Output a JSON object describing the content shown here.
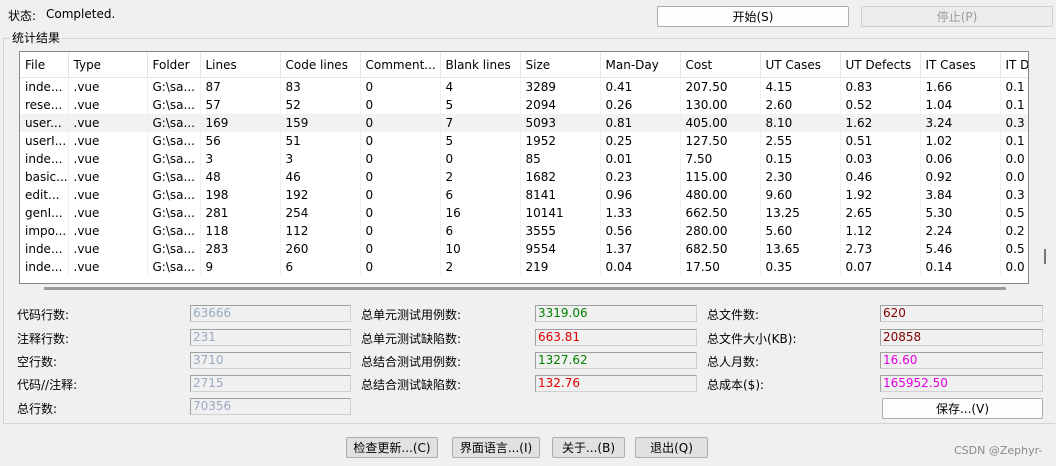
{
  "status": {
    "label": "状态:",
    "value": "Completed."
  },
  "controls": {
    "start": "开始(S)",
    "stop": "停止(P)"
  },
  "group_title": "统计结果",
  "table": {
    "columns": [
      "File",
      "Type",
      "Folder",
      "Lines",
      "Code lines",
      "Comment...",
      "Blank lines",
      "Size",
      "Man-Day",
      "Cost",
      "UT Cases",
      "UT Defects",
      "IT Cases",
      "IT D"
    ],
    "rows": [
      [
        "inde...",
        ".vue",
        "G:\\sa...",
        "87",
        "83",
        "0",
        "4",
        "3289",
        "0.41",
        "207.50",
        "4.15",
        "0.83",
        "1.66",
        "0.1"
      ],
      [
        "rese...",
        ".vue",
        "G:\\sa...",
        "57",
        "52",
        "0",
        "5",
        "2094",
        "0.26",
        "130.00",
        "2.60",
        "0.52",
        "1.04",
        "0.1"
      ],
      [
        "user...",
        ".vue",
        "G:\\sa...",
        "169",
        "159",
        "0",
        "7",
        "5093",
        "0.81",
        "405.00",
        "8.10",
        "1.62",
        "3.24",
        "0.3"
      ],
      [
        "userI...",
        ".vue",
        "G:\\sa...",
        "56",
        "51",
        "0",
        "5",
        "1952",
        "0.25",
        "127.50",
        "2.55",
        "0.51",
        "1.02",
        "0.1"
      ],
      [
        "inde...",
        ".vue",
        "G:\\sa...",
        "3",
        "3",
        "0",
        "0",
        "85",
        "0.01",
        "7.50",
        "0.15",
        "0.03",
        "0.06",
        "0.0"
      ],
      [
        "basic...",
        ".vue",
        "G:\\sa...",
        "48",
        "46",
        "0",
        "2",
        "1682",
        "0.23",
        "115.00",
        "2.30",
        "0.46",
        "0.92",
        "0.0"
      ],
      [
        "edit...",
        ".vue",
        "G:\\sa...",
        "198",
        "192",
        "0",
        "6",
        "8141",
        "0.96",
        "480.00",
        "9.60",
        "1.92",
        "3.84",
        "0.3"
      ],
      [
        "genI...",
        ".vue",
        "G:\\sa...",
        "281",
        "254",
        "0",
        "16",
        "10141",
        "1.33",
        "662.50",
        "13.25",
        "2.65",
        "5.30",
        "0.5"
      ],
      [
        "impo...",
        ".vue",
        "G:\\sa...",
        "118",
        "112",
        "0",
        "6",
        "3555",
        "0.56",
        "280.00",
        "5.60",
        "1.12",
        "2.24",
        "0.2"
      ],
      [
        "inde...",
        ".vue",
        "G:\\sa...",
        "283",
        "260",
        "0",
        "10",
        "9554",
        "1.37",
        "682.50",
        "13.65",
        "2.73",
        "5.46",
        "0.5"
      ],
      [
        "inde...",
        ".vue",
        "G:\\sa...",
        "9",
        "6",
        "0",
        "2",
        "219",
        "0.04",
        "17.50",
        "0.35",
        "0.07",
        "0.14",
        "0.0"
      ]
    ],
    "selected_row": 2
  },
  "stats": {
    "code_lines": {
      "label": "代码行数:",
      "value": "63666"
    },
    "comment_lines": {
      "label": "注释行数:",
      "value": "231"
    },
    "blank_lines": {
      "label": "空行数:",
      "value": "3710"
    },
    "code_comment": {
      "label": "代码//注释:",
      "value": "2715"
    },
    "total_lines": {
      "label": "总行数:",
      "value": "70356"
    },
    "ut_cases": {
      "label": "总单元测试用例数:",
      "value": "3319.06"
    },
    "ut_defects": {
      "label": "总单元测试缺陷数:",
      "value": "663.81"
    },
    "it_cases": {
      "label": "总结合测试用例数:",
      "value": "1327.62"
    },
    "it_defects": {
      "label": "总结合测试缺陷数:",
      "value": "132.76"
    },
    "file_count": {
      "label": "总文件数:",
      "value": "620"
    },
    "file_size": {
      "label": "总文件大小(KB):",
      "value": "20858"
    },
    "man_months": {
      "label": "总人月数:",
      "value": "16.60"
    },
    "total_cost": {
      "label": "总成本($):",
      "value": "165952.50"
    }
  },
  "colors": {
    "gray_value": "#9aaac0",
    "green_value": "#008000",
    "red_value": "#e00000",
    "maroon_value": "#800000",
    "magenta_value": "#e000e0"
  },
  "buttons": {
    "save": "保存...(V)",
    "check_update": "检查更新...(C)",
    "language": "界面语言...(I)",
    "about": "关于...(B)",
    "exit": "退出(Q)"
  },
  "watermark": "CSDN @Zephyr-"
}
